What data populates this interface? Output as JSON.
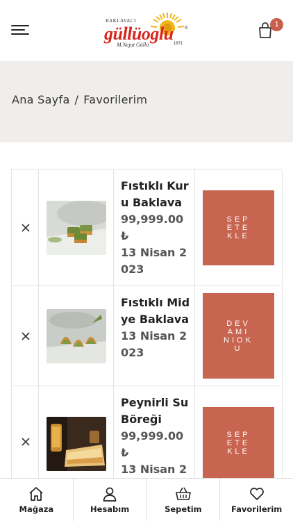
{
  "header": {
    "logo": {
      "top_text": "BAKLAVACI",
      "brand": "güllüoglu",
      "signature": "M.Nejat Güllü",
      "year": "1871",
      "registered": "®"
    },
    "cart_count": "1"
  },
  "breadcrumb": {
    "home": "Ana Sayfa",
    "separator": "/",
    "current": "Favorilerim"
  },
  "favorites": [
    {
      "name": "Fıstıklı Kuru Baklava",
      "price": "99,999.00₺",
      "date": "13 Nisan 2023",
      "action": "SEPETEKLE",
      "thumb": "baklava-pistachio"
    },
    {
      "name": "Fıstıklı Midye Baklava",
      "price": "",
      "date": "13 Nisan 2023",
      "action": "DEVAMINIOKU",
      "thumb": "baklava-midye"
    },
    {
      "name": "Peynirli Su Böreği",
      "price": "99,999.00₺",
      "date": "13 Nisan 2",
      "action": "SEPETEKLE",
      "thumb": "su-boregi"
    }
  ],
  "bottom_nav": [
    {
      "label": "Mağaza",
      "icon": "home-icon"
    },
    {
      "label": "Hesabım",
      "icon": "user-icon"
    },
    {
      "label": "Sepetim",
      "icon": "basket-icon"
    },
    {
      "label": "Favorilerim",
      "icon": "heart-icon"
    }
  ],
  "colors": {
    "accent": "#c86550",
    "brand_red": "#d7261e",
    "band": "#f0eeeb"
  }
}
